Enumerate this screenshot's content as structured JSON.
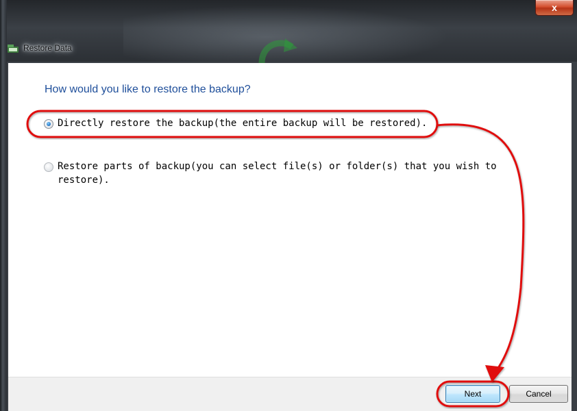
{
  "window": {
    "title": "Restore Data",
    "close_label": "x"
  },
  "main": {
    "heading": "How would you like to restore the backup?",
    "options": [
      {
        "label": "Directly restore the backup(the entire backup will be restored).",
        "selected": true
      },
      {
        "label": "Restore parts of backup(you can select file(s) or folder(s) that you wish to restore).",
        "selected": false
      }
    ]
  },
  "footer": {
    "next_label": "Next",
    "cancel_label": "Cancel"
  },
  "colors": {
    "heading": "#1e4e9a",
    "annotation": "#e01010",
    "close_button": "#c4401f"
  },
  "icons": [
    "app-icon",
    "close-icon",
    "radio-checked-icon",
    "radio-unchecked-icon",
    "refresh-arrow-icon"
  ]
}
